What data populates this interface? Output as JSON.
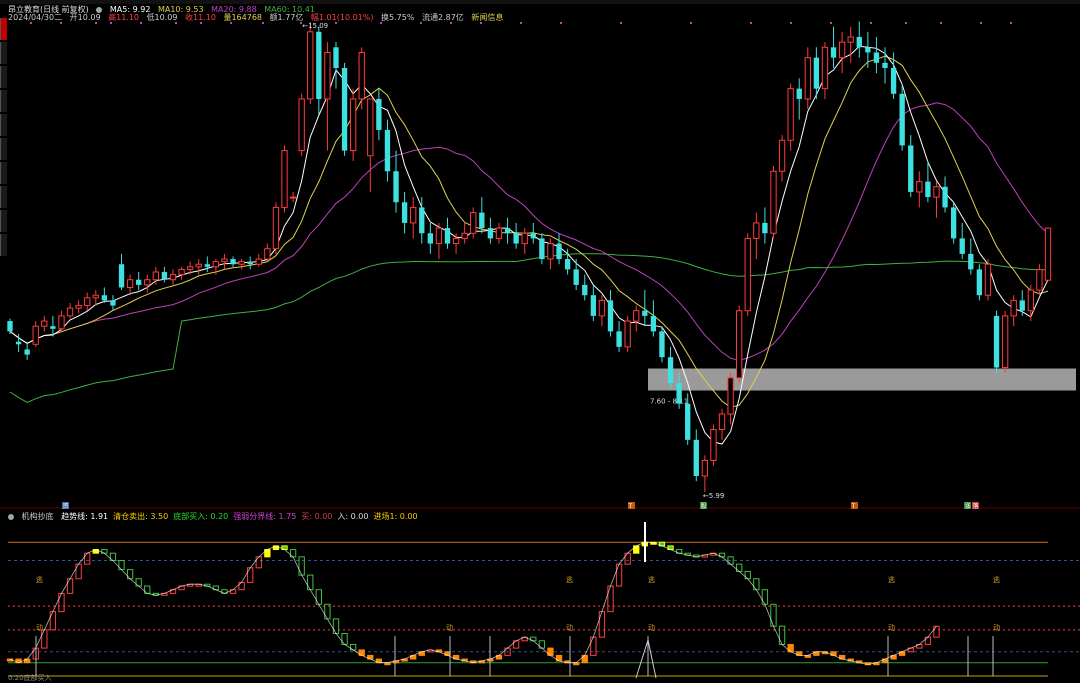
{
  "window": {
    "stock_name": "昂立教育(日线 前复权)",
    "left_tabs": [
      "tab-1",
      "tab-2",
      "tab-3",
      "tab-4",
      "tab-5",
      "tab-6",
      "tab-7",
      "tab-8",
      "tab-9",
      "tab-10"
    ]
  },
  "ma_legend": {
    "ma5": "MA5: 9.92",
    "ma10": "MA10: 9.53",
    "ma20": "MA20: 9.88",
    "ma60": "MA60: 10.41"
  },
  "ohlc": {
    "date": "2024/04/30二",
    "open": "开10.09",
    "high": "高11.10",
    "low": "低10.09",
    "close": "收11.10",
    "volume": "量164768",
    "amount": "额1.77亿",
    "change": "幅1.01(10.01%)",
    "turnover": "换5.75%",
    "float_cap": "流通2.87亿",
    "news": "新闻信息"
  },
  "annotations": {
    "high_label": "15.09",
    "low_label": "5.99",
    "zone_label": "7.60 - 8.11"
  },
  "markers": [
    {
      "text": "资",
      "color": "#3a6aa8"
    },
    {
      "text": "T",
      "color": "#cc5500"
    },
    {
      "text": "股",
      "color": "#2f8a2f"
    },
    {
      "text": "T",
      "color": "#cc5500"
    },
    {
      "text": "涨",
      "color": "#2f8a2f"
    },
    {
      "text": "落",
      "color": "#c03030"
    }
  ],
  "indicator": {
    "name": "机构抄底",
    "items": [
      {
        "text": "趋势线: 1.91",
        "color": "#ffffff"
      },
      {
        "text": "清仓卖出: 3.50",
        "color": "#ffcc00"
      },
      {
        "text": "底部买入: 0.20",
        "color": "#22dd22"
      },
      {
        "text": "强弱分界线: 1.75",
        "color": "#cc44cc"
      },
      {
        "text": "买: 0.00",
        "color": "#cc4444"
      },
      {
        "text": "入: 0.00",
        "color": "#dddddd"
      },
      {
        "text": "进场1: 0.00",
        "color": "#ffcc00"
      }
    ],
    "sell_signal": "逃",
    "buy_signal": "动",
    "bottom_label": "0.20底部买入"
  },
  "colors": {
    "up": "#ff3b3b",
    "down": "#3fe0e0",
    "ma5": "#ffffff",
    "ma10": "#e0d050",
    "ma20": "#c040c0",
    "ma60": "#40b040",
    "zone": "#9a9a9a"
  },
  "chart_data": {
    "type": "candlestick",
    "candles": [
      [
        9.3,
        9.35,
        9.05,
        9.1
      ],
      [
        8.9,
        9.05,
        8.7,
        8.85
      ],
      [
        8.75,
        8.9,
        8.55,
        8.65
      ],
      [
        8.85,
        9.3,
        8.8,
        9.2
      ],
      [
        9.2,
        9.4,
        9.1,
        9.3
      ],
      [
        9.2,
        9.4,
        9.0,
        9.15
      ],
      [
        9.15,
        9.5,
        9.1,
        9.4
      ],
      [
        9.4,
        9.65,
        9.35,
        9.55
      ],
      [
        9.55,
        9.7,
        9.45,
        9.6
      ],
      [
        9.6,
        9.85,
        9.5,
        9.75
      ],
      [
        9.75,
        9.9,
        9.6,
        9.8
      ],
      [
        9.8,
        9.95,
        9.65,
        9.7
      ],
      [
        9.7,
        9.8,
        9.5,
        9.6
      ],
      [
        10.4,
        10.6,
        9.9,
        9.95
      ],
      [
        9.95,
        10.2,
        9.8,
        10.1
      ],
      [
        10.1,
        10.25,
        9.9,
        10.0
      ],
      [
        10.0,
        10.2,
        9.85,
        10.1
      ],
      [
        10.1,
        10.35,
        10.0,
        10.25
      ],
      [
        10.25,
        10.35,
        10.05,
        10.1
      ],
      [
        10.1,
        10.3,
        10.0,
        10.2
      ],
      [
        10.2,
        10.35,
        10.1,
        10.3
      ],
      [
        10.3,
        10.45,
        10.2,
        10.35
      ],
      [
        10.35,
        10.5,
        10.2,
        10.4
      ],
      [
        10.4,
        10.55,
        10.25,
        10.35
      ],
      [
        10.35,
        10.5,
        10.2,
        10.45
      ],
      [
        10.45,
        10.6,
        10.3,
        10.5
      ],
      [
        10.5,
        10.55,
        10.35,
        10.4
      ],
      [
        10.4,
        10.5,
        10.3,
        10.45
      ],
      [
        10.45,
        10.55,
        10.3,
        10.4
      ],
      [
        10.4,
        10.6,
        10.35,
        10.5
      ],
      [
        10.5,
        10.8,
        10.45,
        10.7
      ],
      [
        10.7,
        11.6,
        10.6,
        11.5
      ],
      [
        11.5,
        12.7,
        11.4,
        12.6
      ],
      [
        11.7,
        11.8,
        11.6,
        11.7
      ],
      [
        12.6,
        13.7,
        12.5,
        13.6
      ],
      [
        13.6,
        15.09,
        13.5,
        14.9
      ],
      [
        14.9,
        15.0,
        13.3,
        13.6
      ],
      [
        13.6,
        14.7,
        12.6,
        14.5
      ],
      [
        14.6,
        14.7,
        13.8,
        14.2
      ],
      [
        14.2,
        14.3,
        12.5,
        12.6
      ],
      [
        12.6,
        13.8,
        12.4,
        13.6
      ],
      [
        13.6,
        14.6,
        13.4,
        14.5
      ],
      [
        12.5,
        13.6,
        11.8,
        13.6
      ],
      [
        13.6,
        13.8,
        12.8,
        13.0
      ],
      [
        13.0,
        13.2,
        12.0,
        12.2
      ],
      [
        12.2,
        12.6,
        11.4,
        11.6
      ],
      [
        11.6,
        11.8,
        11.0,
        11.2
      ],
      [
        11.2,
        11.7,
        10.9,
        11.5
      ],
      [
        11.5,
        11.7,
        10.8,
        11.0
      ],
      [
        11.0,
        11.2,
        10.6,
        10.8
      ],
      [
        10.8,
        11.2,
        10.5,
        11.1
      ],
      [
        11.1,
        11.3,
        10.7,
        10.8
      ],
      [
        10.8,
        11.0,
        10.6,
        10.9
      ],
      [
        10.9,
        11.2,
        10.8,
        11.0
      ],
      [
        11.0,
        11.5,
        10.9,
        11.4
      ],
      [
        11.4,
        11.7,
        11.0,
        11.1
      ],
      [
        11.1,
        11.3,
        10.8,
        10.9
      ],
      [
        10.9,
        11.2,
        10.8,
        11.1
      ],
      [
        11.1,
        11.3,
        10.8,
        11.0
      ],
      [
        11.0,
        11.2,
        10.7,
        10.8
      ],
      [
        10.8,
        11.1,
        10.6,
        11.0
      ],
      [
        11.0,
        11.2,
        10.8,
        10.9
      ],
      [
        10.9,
        11.0,
        10.4,
        10.5
      ],
      [
        10.5,
        10.9,
        10.3,
        10.8
      ],
      [
        10.8,
        11.0,
        10.4,
        10.5
      ],
      [
        10.5,
        10.7,
        10.2,
        10.3
      ],
      [
        10.3,
        10.5,
        9.9,
        10.0
      ],
      [
        10.0,
        10.2,
        9.7,
        9.8
      ],
      [
        9.8,
        10.0,
        9.3,
        9.4
      ],
      [
        9.4,
        9.8,
        9.2,
        9.7
      ],
      [
        9.7,
        9.9,
        9.0,
        9.1
      ],
      [
        9.1,
        9.3,
        8.7,
        8.8
      ],
      [
        8.8,
        9.4,
        8.7,
        9.3
      ],
      [
        9.3,
        9.6,
        9.1,
        9.5
      ],
      [
        9.5,
        9.9,
        9.2,
        9.4
      ],
      [
        9.4,
        9.7,
        9.0,
        9.1
      ],
      [
        9.1,
        9.2,
        8.5,
        8.6
      ],
      [
        8.6,
        8.8,
        8.0,
        8.1
      ],
      [
        8.1,
        8.3,
        7.6,
        7.7
      ],
      [
        7.7,
        7.9,
        6.9,
        7.0
      ],
      [
        7.0,
        7.2,
        6.2,
        6.3
      ],
      [
        6.3,
        6.7,
        5.99,
        6.6
      ],
      [
        6.6,
        7.3,
        6.5,
        7.2
      ],
      [
        7.2,
        7.6,
        7.0,
        7.5
      ],
      [
        7.5,
        8.3,
        7.3,
        8.2
      ],
      [
        8.2,
        9.6,
        8.1,
        9.5
      ],
      [
        9.5,
        11.0,
        9.4,
        10.9
      ],
      [
        10.9,
        11.4,
        10.5,
        11.2
      ],
      [
        11.2,
        11.5,
        10.8,
        11.0
      ],
      [
        11.0,
        12.3,
        10.9,
        12.2
      ],
      [
        12.2,
        12.9,
        12.0,
        12.8
      ],
      [
        12.8,
        13.9,
        12.6,
        13.8
      ],
      [
        13.8,
        14.0,
        13.2,
        13.6
      ],
      [
        13.6,
        14.6,
        13.4,
        14.4
      ],
      [
        14.4,
        14.6,
        13.6,
        13.8
      ],
      [
        13.8,
        14.7,
        13.6,
        14.6
      ],
      [
        14.6,
        15.0,
        14.2,
        14.4
      ],
      [
        14.4,
        14.9,
        14.1,
        14.7
      ],
      [
        14.7,
        15.0,
        14.3,
        14.8
      ],
      [
        14.8,
        15.1,
        14.4,
        14.6
      ],
      [
        14.6,
        14.9,
        14.2,
        14.5
      ],
      [
        14.5,
        14.8,
        14.1,
        14.3
      ],
      [
        14.3,
        14.6,
        13.9,
        14.2
      ],
      [
        14.2,
        14.5,
        13.6,
        13.7
      ],
      [
        13.7,
        13.9,
        12.6,
        12.7
      ],
      [
        12.7,
        12.9,
        11.7,
        11.8
      ],
      [
        11.8,
        12.2,
        11.5,
        12.0
      ],
      [
        12.0,
        12.4,
        11.6,
        11.7
      ],
      [
        11.7,
        12.0,
        11.3,
        11.9
      ],
      [
        11.9,
        12.1,
        11.4,
        11.5
      ],
      [
        11.5,
        11.6,
        10.8,
        10.9
      ],
      [
        10.9,
        11.2,
        10.5,
        10.6
      ],
      [
        10.6,
        10.9,
        10.2,
        10.3
      ],
      [
        10.3,
        10.4,
        9.7,
        9.8
      ],
      [
        9.8,
        10.5,
        9.7,
        10.4
      ],
      [
        9.4,
        9.5,
        8.3,
        8.4
      ],
      [
        8.4,
        9.5,
        8.3,
        9.4
      ],
      [
        9.4,
        9.8,
        9.2,
        9.7
      ],
      [
        9.7,
        9.9,
        9.4,
        9.5
      ],
      [
        9.5,
        10.0,
        9.3,
        9.9
      ],
      [
        9.9,
        10.4,
        9.8,
        10.3
      ],
      [
        10.09,
        11.1,
        10.09,
        11.1
      ]
    ],
    "ma_series": [
      "MA5",
      "MA10",
      "MA20",
      "MA60"
    ],
    "high_price": 15.09,
    "low_price": 5.99,
    "zone_range": [
      7.6,
      8.11
    ],
    "indicator_line": [
      0.3,
      0.2,
      0.3,
      0.6,
      1.1,
      1.6,
      2.1,
      2.5,
      2.9,
      3.2,
      3.3,
      3.2,
      3.0,
      2.75,
      2.5,
      2.3,
      2.1,
      2.05,
      2.1,
      2.2,
      2.3,
      2.35,
      2.35,
      2.3,
      2.2,
      2.1,
      2.2,
      2.4,
      2.8,
      3.1,
      3.3,
      3.4,
      3.3,
      3.1,
      2.6,
      2.2,
      1.8,
      1.4,
      1.0,
      0.7,
      0.55,
      0.4,
      0.3,
      0.2,
      0.2,
      0.25,
      0.3,
      0.4,
      0.5,
      0.55,
      0.5,
      0.4,
      0.3,
      0.25,
      0.2,
      0.25,
      0.3,
      0.4,
      0.6,
      0.8,
      0.9,
      0.8,
      0.6,
      0.4,
      0.25,
      0.2,
      0.2,
      0.4,
      0.9,
      1.6,
      2.3,
      2.9,
      3.2,
      3.4,
      3.5,
      3.5,
      3.4,
      3.3,
      3.2,
      3.15,
      3.1,
      3.15,
      3.2,
      3.1,
      2.9,
      2.7,
      2.5,
      2.2,
      1.8,
      1.2,
      0.7,
      0.5,
      0.4,
      0.4,
      0.5,
      0.5,
      0.4,
      0.3,
      0.25,
      0.2,
      0.15,
      0.2,
      0.3,
      0.4,
      0.5,
      0.6,
      0.7,
      0.9,
      1.2
    ],
    "indicator_levels": {
      "sell": 3.5,
      "divider": 1.75,
      "buy": 0.2
    }
  }
}
